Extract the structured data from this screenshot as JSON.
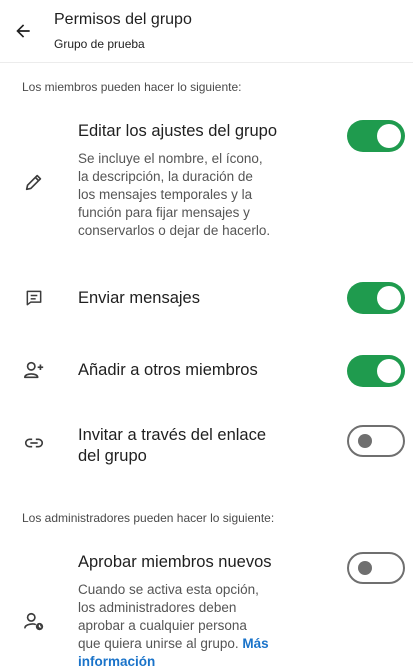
{
  "header": {
    "title": "Permisos del grupo",
    "subtitle": "Grupo de prueba",
    "back_icon": "arrow-left-icon"
  },
  "members_section": {
    "label": "Los miembros pueden hacer lo siguiente:"
  },
  "permissions": [
    {
      "title": "Editar los ajustes del grupo",
      "description": [
        "Se incluye el nombre, el ícono,",
        "la descripción, la duración de",
        "los mensajes temporales y la",
        "función para fijar mensajes y",
        "conservarlos o dejar de hacerlo."
      ],
      "icon": "pencil-icon",
      "enabled": true
    },
    {
      "title": "Enviar mensajes",
      "icon": "message-icon",
      "enabled": true
    },
    {
      "title": "Añadir a otros miembros",
      "icon": "add-person-icon",
      "enabled": true
    },
    {
      "title_lines": [
        "Invitar a través del enlace",
        "del grupo"
      ],
      "icon": "link-icon",
      "enabled": false
    }
  ],
  "admins_section": {
    "label": "Los administradores pueden hacer lo siguiente:"
  },
  "admin_permissions": [
    {
      "title": "Aprobar miembros nuevos",
      "description": [
        "Cuando se activa esta opción,",
        "los administradores deben",
        "aprobar a cualquier persona"
      ],
      "description_last_plain": "que quiera unirse al grupo. ",
      "link_part1": "Más",
      "link_part2": "información",
      "icon": "pending-person-icon",
      "enabled": false
    }
  ],
  "colors": {
    "toggle_on": "#1f9b4e",
    "toggle_off": "#6f6f6f",
    "link": "#1a73c9"
  }
}
